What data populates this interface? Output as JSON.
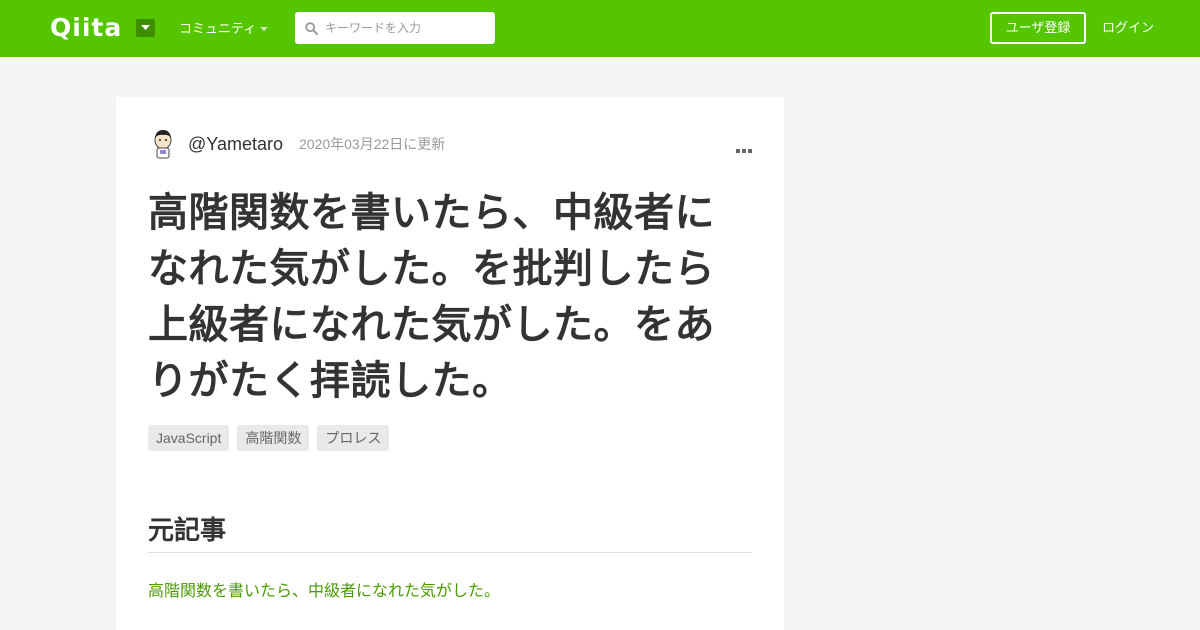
{
  "header": {
    "logo": "Qiita",
    "community_label": "コミュニティ",
    "search_placeholder": "キーワードを入力",
    "search_value": "",
    "signup_label": "ユーザ登録",
    "login_label": "ログイン",
    "brand_color": "#55c500"
  },
  "article": {
    "author": "@Yametaro",
    "updated": "2020年03月22日に更新",
    "title": "高階関数を書いたら、中級者になれた気がした。を批判したら上級者になれた気がした。をありがたく拝読した。",
    "tags": [
      "JavaScript",
      "高階関数",
      "プロレス"
    ],
    "section_heading": "元記事",
    "link_text": "高階関数を書いたら、中級者になれた気がした。",
    "link_color": "#4b9a00"
  },
  "icons": {
    "logo_caret": "chevron-down-icon",
    "community_caret": "chevron-down-icon",
    "search": "search-icon",
    "more": "more-horizontal-icon",
    "avatar": "avatar-image"
  }
}
